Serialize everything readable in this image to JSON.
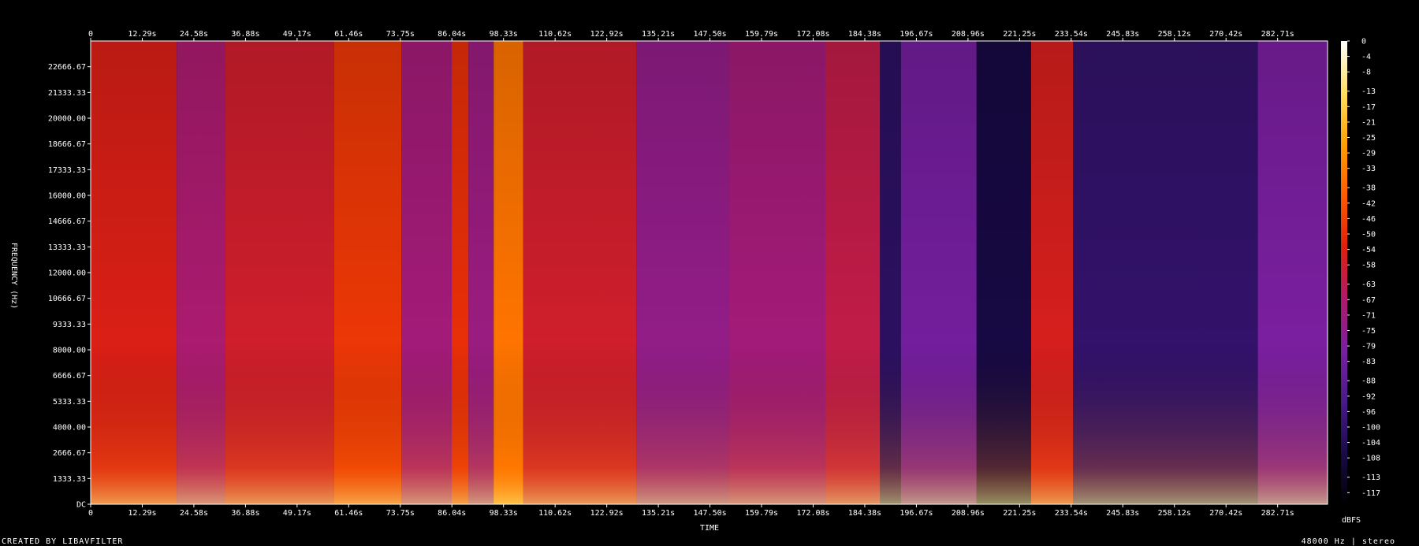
{
  "chart_data": {
    "type": "heatmap",
    "title": "",
    "xlabel": "TIME",
    "ylabel": "FREQUENCY (Hz)",
    "colorbar_label": "dBFS",
    "x_ticks": [
      "0",
      "12.29s",
      "24.58s",
      "36.88s",
      "49.17s",
      "61.46s",
      "73.75s",
      "86.04s",
      "98.33s",
      "110.62s",
      "122.92s",
      "135.21s",
      "147.50s",
      "159.79s",
      "172.08s",
      "184.38s",
      "196.67s",
      "208.96s",
      "221.25s",
      "233.54s",
      "245.83s",
      "258.12s",
      "270.42s",
      "282.71s"
    ],
    "x_values": [
      0,
      12.29,
      24.58,
      36.88,
      49.17,
      61.46,
      73.75,
      86.04,
      98.33,
      110.62,
      122.92,
      135.21,
      147.5,
      159.79,
      172.08,
      184.38,
      196.67,
      208.96,
      221.25,
      233.54,
      245.83,
      258.12,
      270.42,
      282.71
    ],
    "xlim": [
      0,
      294.6
    ],
    "y_ticks": [
      "DC",
      "1333.33",
      "2666.67",
      "4000.00",
      "5333.33",
      "6666.67",
      "8000.00",
      "9333.33",
      "10666.67",
      "12000.00",
      "13333.33",
      "14666.67",
      "16000.00",
      "17333.33",
      "18666.67",
      "20000.00",
      "21333.33",
      "22666.67"
    ],
    "y_values": [
      0,
      1333.33,
      2666.67,
      4000,
      5333.33,
      6666.67,
      8000,
      9333.33,
      10666.67,
      12000,
      13333.33,
      14666.67,
      16000,
      17333.33,
      18666.67,
      20000,
      21333.33,
      22666.67
    ],
    "ylim": [
      0,
      24000
    ],
    "colorbar_ticks": [
      "0",
      "-4",
      "-8",
      "-13",
      "-17",
      "-21",
      "-25",
      "-29",
      "-33",
      "-38",
      "-42",
      "-46",
      "-50",
      "-54",
      "-58",
      "-63",
      "-67",
      "-71",
      "-75",
      "-79",
      "-83",
      "-88",
      "-92",
      "-96",
      "-100",
      "-104",
      "-108",
      "-113",
      "-117"
    ],
    "colorbar_values": [
      0,
      -4,
      -8,
      -13,
      -17,
      -21,
      -25,
      -29,
      -33,
      -38,
      -42,
      -46,
      -50,
      -54,
      -58,
      -63,
      -67,
      -71,
      -75,
      -79,
      -83,
      -88,
      -92,
      -96,
      -100,
      -104,
      -108,
      -113,
      -117
    ],
    "colorbar_range": [
      -120,
      0
    ],
    "colormap": [
      "#000000",
      "#1a0a4a",
      "#4a1a8a",
      "#7a1fa0",
      "#b01a6a",
      "#e0200a",
      "#ff5a00",
      "#ffa000",
      "#ffe060",
      "#ffffff"
    ],
    "segments": [
      {
        "t": [
          0,
          20.5
        ],
        "level": -55
      },
      {
        "t": [
          20.5,
          32
        ],
        "level": -68
      },
      {
        "t": [
          32,
          58
        ],
        "level": -58
      },
      {
        "t": [
          58,
          74
        ],
        "level": -48
      },
      {
        "t": [
          74,
          86
        ],
        "level": -70
      },
      {
        "t": [
          86,
          90
        ],
        "level": -50
      },
      {
        "t": [
          90,
          96
        ],
        "level": -72
      },
      {
        "t": [
          96,
          103
        ],
        "level": -35
      },
      {
        "t": [
          103,
          130
        ],
        "level": -58
      },
      {
        "t": [
          130,
          152
        ],
        "level": -74
      },
      {
        "t": [
          152,
          175
        ],
        "level": -70
      },
      {
        "t": [
          175,
          188
        ],
        "level": -62
      },
      {
        "t": [
          188,
          193
        ],
        "level": -102
      },
      {
        "t": [
          193,
          211
        ],
        "level": -82
      },
      {
        "t": [
          211,
          224
        ],
        "level": -108
      },
      {
        "t": [
          224,
          234
        ],
        "level": -56
      },
      {
        "t": [
          234,
          278
        ],
        "level": -100
      },
      {
        "t": [
          278,
          294.6
        ],
        "level": -80
      }
    ],
    "footer_left": "CREATED BY LIBAVFILTER",
    "footer_right": "48000 Hz | stereo"
  }
}
